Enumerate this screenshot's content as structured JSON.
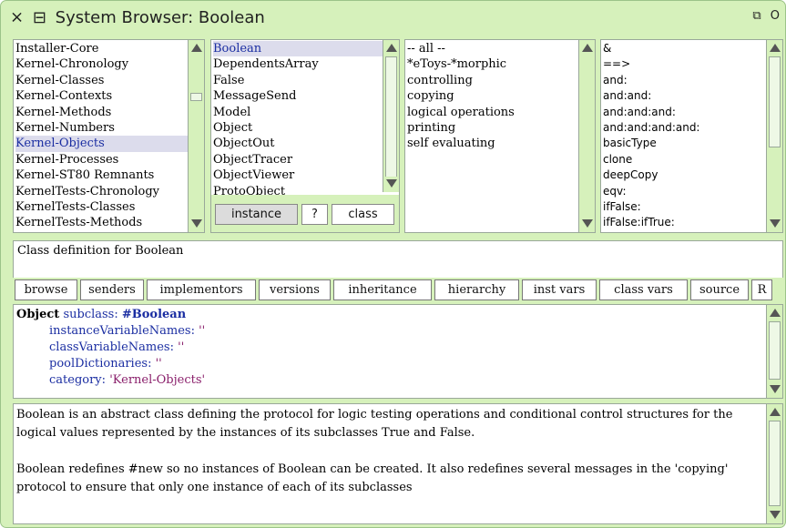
{
  "window": {
    "close_glyph": "×",
    "menu_glyph": "⊟",
    "title": "System Browser: Boolean",
    "collapse_glyph": "⧉",
    "expand_glyph": "O"
  },
  "categories": {
    "items": [
      "Installer-Core",
      "Kernel-Chronology",
      "Kernel-Classes",
      "Kernel-Contexts",
      "Kernel-Methods",
      "Kernel-Numbers",
      "Kernel-Objects",
      "Kernel-Processes",
      "Kernel-ST80 Remnants",
      "KernelTests-Chronology",
      "KernelTests-Classes",
      "KernelTests-Methods"
    ],
    "selected": "Kernel-Objects"
  },
  "classes": {
    "items": [
      "Boolean",
      "DependentsArray",
      "False",
      "MessageSend",
      "Model",
      "Object",
      "ObjectOut",
      "ObjectTracer",
      "ObjectViewer",
      "ProtoObject"
    ],
    "selected": "Boolean",
    "instance_label": "instance",
    "help_label": "?",
    "class_label": "class"
  },
  "protocols": {
    "items": [
      "-- all --",
      "*eToys-*morphic",
      "controlling",
      "copying",
      "logical operations",
      "printing",
      "self evaluating"
    ]
  },
  "selectors": {
    "items": [
      "&",
      "==>",
      "and:",
      "and:and:",
      "and:and:and:",
      "and:and:and:and:",
      "basicType",
      "clone",
      "deepCopy",
      "eqv:",
      "ifFalse:",
      "ifFalse:ifTrue:"
    ]
  },
  "annotation": {
    "text": "Class definition for Boolean"
  },
  "toolbar": {
    "buttons": [
      "browse",
      "senders",
      "implementors",
      "versions",
      "inheritance",
      "hierarchy",
      "inst vars",
      "class vars",
      "source",
      "R"
    ]
  },
  "definition": {
    "superclass": "Object",
    "subclass_kw": "subclass:",
    "class_symbol": "#Boolean",
    "ivn_kw": "instanceVariableNames:",
    "ivn_val": "''",
    "cvn_kw": "classVariableNames:",
    "cvn_val": "''",
    "pool_kw": "poolDictionaries:",
    "pool_val": "''",
    "cat_kw": "category:",
    "cat_val": "'Kernel-Objects'"
  },
  "comment": {
    "para1": "Boolean is an abstract class defining the protocol for logic testing operations and conditional control structures for the logical values represented by the instances of its subclasses True and False.",
    "para2": "Boolean redefines #new so no instances of Boolean can be created. It also redefines several messages in the 'copying' protocol to ensure that only one instance of each of its subclasses"
  },
  "colors": {
    "window_bg": "#d6f1bb",
    "selection": "#dcdcec",
    "keyword_blue": "#1b2ea2",
    "string_purple": "#8a1f6b"
  }
}
